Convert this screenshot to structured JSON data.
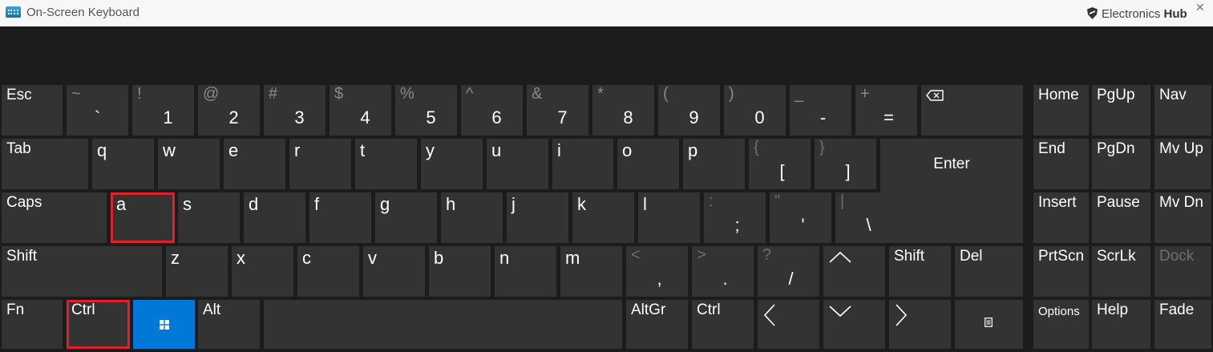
{
  "window": {
    "title": "On-Screen Keyboard",
    "brand_prefix": "Electronics",
    "brand_suffix": "Hub"
  },
  "keys": {
    "esc": "Esc",
    "tilde": {
      "top": "~",
      "bottom": "`"
    },
    "one": {
      "top": "!",
      "bottom": "1"
    },
    "two": {
      "top": "@",
      "bottom": "2"
    },
    "three": {
      "top": "#",
      "bottom": "3"
    },
    "four": {
      "top": "$",
      "bottom": "4"
    },
    "five": {
      "top": "%",
      "bottom": "5"
    },
    "six": {
      "top": "^",
      "bottom": "6"
    },
    "seven": {
      "top": "&",
      "bottom": "7"
    },
    "eight": {
      "top": "*",
      "bottom": "8"
    },
    "nine": {
      "top": "(",
      "bottom": "9"
    },
    "zero": {
      "top": ")",
      "bottom": "0"
    },
    "minus": {
      "top": "_",
      "bottom": "-"
    },
    "equals": {
      "top": "+",
      "bottom": "="
    },
    "tab": "Tab",
    "q": "q",
    "w": "w",
    "e": "e",
    "r": "r",
    "t": "t",
    "y": "y",
    "u": "u",
    "i": "i",
    "o": "o",
    "p": "p",
    "lbracket": {
      "top": "{",
      "bottom": "["
    },
    "rbracket": {
      "top": "}",
      "bottom": "]"
    },
    "enter": "Enter",
    "caps": "Caps",
    "a": "a",
    "s": "s",
    "d": "d",
    "f": "f",
    "g": "g",
    "h": "h",
    "j": "j",
    "k": "k",
    "l": "l",
    "semicolon": {
      "top": ":",
      "bottom": ";"
    },
    "quote": {
      "top": "\"",
      "bottom": "'"
    },
    "backslash": {
      "top": "|",
      "bottom": "\\"
    },
    "shift_left": "Shift",
    "z": "z",
    "x": "x",
    "c": "c",
    "v": "v",
    "b": "b",
    "n": "n",
    "m": "m",
    "comma": {
      "top": "<",
      "bottom": ","
    },
    "period": {
      "top": ">",
      "bottom": "."
    },
    "slash": {
      "top": "?",
      "bottom": "/"
    },
    "shift_right": "Shift",
    "del": "Del",
    "fn": "Fn",
    "ctrl_left": "Ctrl",
    "alt": "Alt",
    "altgr": "AltGr",
    "ctrl_right": "Ctrl",
    "home": "Home",
    "pgup": "PgUp",
    "nav": "Nav",
    "end": "End",
    "pgdn": "PgDn",
    "mvup": "Mv Up",
    "insert": "Insert",
    "pause": "Pause",
    "mvdn": "Mv Dn",
    "prtscn": "PrtScn",
    "scrlk": "ScrLk",
    "dock": "Dock",
    "options": "Options",
    "help": "Help",
    "fade": "Fade"
  },
  "icons": [
    "backspace-icon",
    "windows-logo-icon",
    "arrow-up-icon",
    "arrow-left-icon",
    "arrow-down-icon",
    "arrow-right-icon",
    "context-menu-icon",
    "shield-logo-icon"
  ],
  "colors": {
    "key": "#333333",
    "background": "#1c1c1c",
    "windows_key": "#0078d7",
    "highlight": "#e0202a"
  }
}
